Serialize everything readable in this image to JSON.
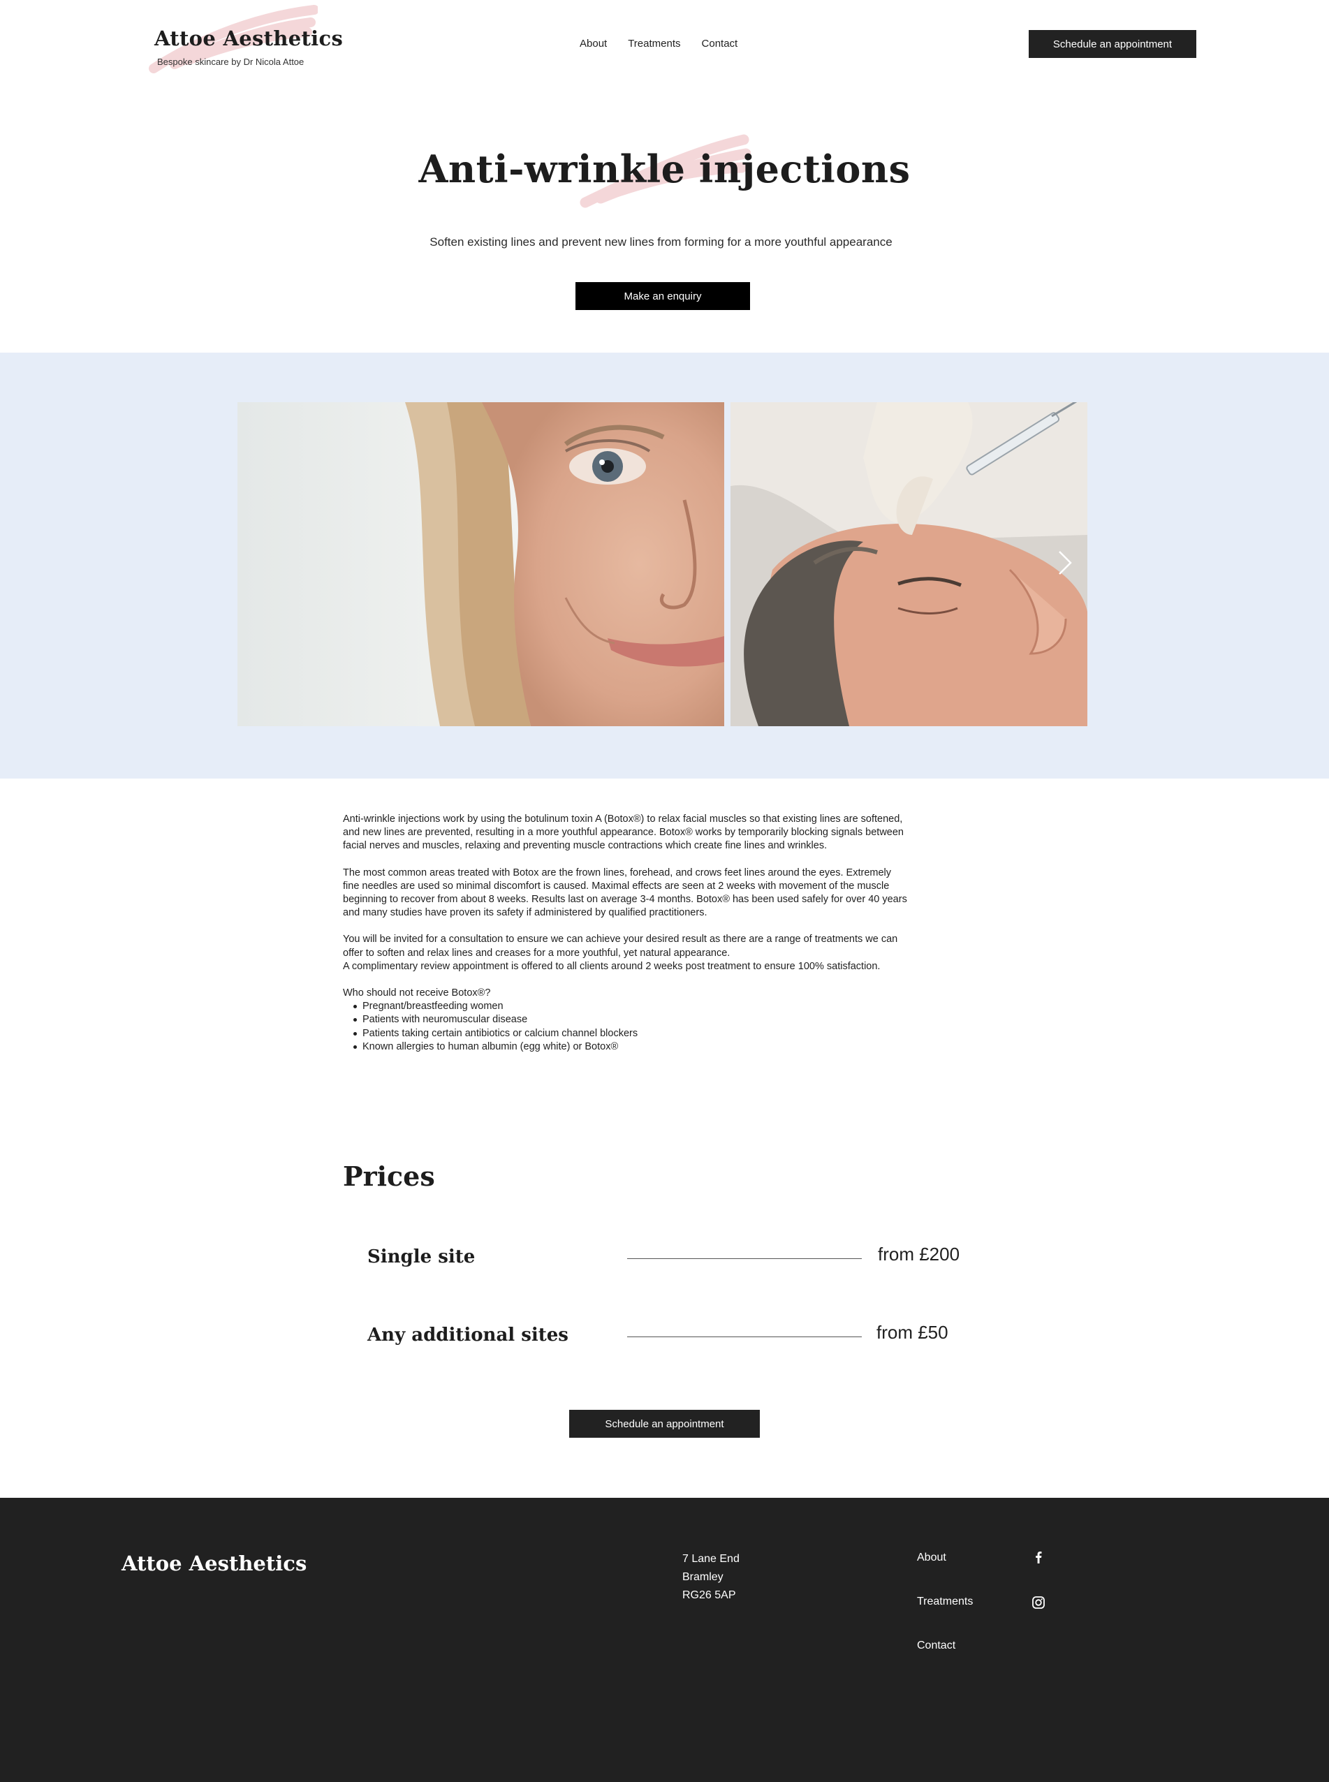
{
  "header": {
    "logo": "Attoe Aesthetics",
    "tagline": "Bespoke skincare by Dr Nicola Attoe",
    "nav": [
      "About",
      "Treatments",
      "Contact"
    ],
    "cta": "Schedule an appointment",
    "brush_color": "#f3d3d5"
  },
  "hero": {
    "title": "Anti-wrinkle injections",
    "subtitle": "Soften existing lines and prevent new lines from forming for a more youthful appearance",
    "cta": "Make an enquiry"
  },
  "gallery": {
    "background": "#e6edf8",
    "images": [
      "woman-face-closeup-image",
      "forehead-injection-treatment-image"
    ],
    "next_icon": "chevron-right-icon"
  },
  "content": {
    "paragraphs": [
      "Anti-wrinkle injections work by using the botulinum toxin A (Botox®) to relax facial muscles so that existing lines are softened, and new lines are prevented, resulting in a more youthful appearance. Botox® works by temporarily blocking signals between facial nerves and muscles, relaxing and preventing muscle contractions which create fine lines and wrinkles.",
      "The most common areas treated with Botox are the frown lines, forehead, and crows feet lines around the eyes. Extremely fine needles are used so minimal discomfort is caused. Maximal effects are seen at 2 weeks with movement of the muscle beginning to recover from about 8 weeks. Results last on average 3-4 months. Botox® has been used safely for over 40 years and many studies have proven its safety if administered by qualified practitioners.",
      "You will be invited for a consultation to ensure we can achieve your desired result as there are a range of treatments we can offer to soften and relax lines and creases for a more youthful, yet natural appearance.",
      "A complimentary review appointment is offered to all clients around 2 weeks post treatment to ensure 100% satisfaction."
    ],
    "question": "Who should not receive Botox®?",
    "list": [
      "Pregnant/breastfeeding women",
      "Patients with neuromuscular disease",
      "Patients taking certain antibiotics or calcium channel blockers",
      "Known allergies to human albumin (egg white) or Botox®"
    ]
  },
  "prices": {
    "title": "Prices",
    "items": [
      {
        "name": "Single site",
        "price": "from £200"
      },
      {
        "name": "Any additional sites",
        "price": "from £50"
      }
    ],
    "cta": "Schedule an appointment"
  },
  "footer": {
    "logo": "Attoe Aesthetics",
    "address": [
      "7 Lane End",
      "Bramley",
      "RG26 5AP"
    ],
    "links": [
      "About",
      "Treatments",
      "Contact"
    ],
    "social": [
      "facebook-icon",
      "instagram-icon"
    ],
    "background": "#212121"
  }
}
